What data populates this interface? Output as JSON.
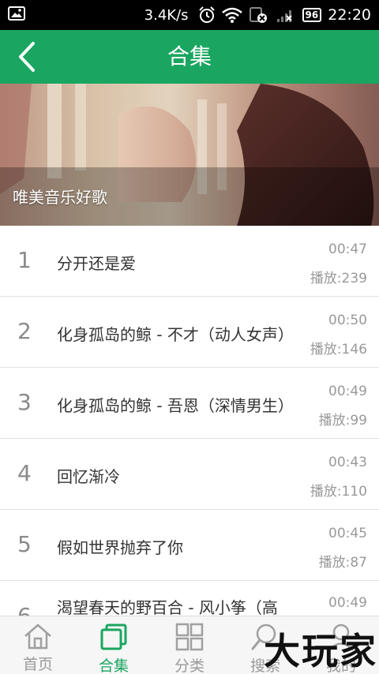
{
  "status_bar": {
    "speed": "3.4K/s",
    "battery": "96",
    "time": "22:20"
  },
  "header": {
    "title": "合集"
  },
  "banner": {
    "caption": "唯美音乐好歌"
  },
  "songs": [
    {
      "index": "1",
      "title": "分开还是爱",
      "duration": "00:47",
      "plays": "播放:239"
    },
    {
      "index": "2",
      "title": "化身孤岛的鲸 - 不才（动人女声）",
      "duration": "00:50",
      "plays": "播放:146"
    },
    {
      "index": "3",
      "title": "化身孤岛的鲸 - 吾恩（深情男生）",
      "duration": "00:49",
      "plays": "播放:99"
    },
    {
      "index": "4",
      "title": "回忆渐冷",
      "duration": "00:43",
      "plays": "播放:110"
    },
    {
      "index": "5",
      "title": "假如世界抛弃了你",
      "duration": "00:45",
      "plays": "播放:87"
    },
    {
      "index": "6",
      "title": "渴望春天的野百合 - 风小筝（高",
      "duration": "00:49",
      "plays": ""
    }
  ],
  "bottom_nav": [
    {
      "label": "首页",
      "icon": "home-icon",
      "active": false
    },
    {
      "label": "合集",
      "icon": "collection-icon",
      "active": true
    },
    {
      "label": "分类",
      "icon": "grid-icon",
      "active": false
    },
    {
      "label": "搜索",
      "icon": "search-icon",
      "active": false
    },
    {
      "label": "我的",
      "icon": "user-icon",
      "active": false
    }
  ],
  "watermark": "大玩家",
  "colors": {
    "accent": "#1aa660",
    "inactive": "#9a9a9a"
  }
}
